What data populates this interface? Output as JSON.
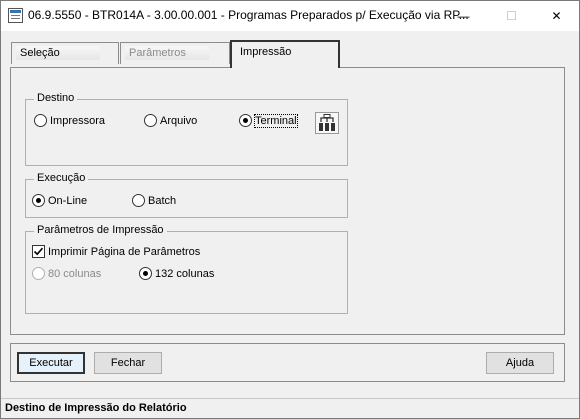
{
  "window": {
    "title": "06.9.5550 - BTR014A - 3.00.00.001 - Programas Preparados p/ Execução via RP...",
    "minimize_glyph": "—",
    "maximize_glyph": "☐",
    "close_glyph": "✕"
  },
  "tabs": [
    {
      "label": "Seleção",
      "state": "normal"
    },
    {
      "label": "Parâmetros",
      "state": "disabled"
    },
    {
      "label": "Impressão",
      "state": "active"
    }
  ],
  "destino": {
    "title": "Destino",
    "options": [
      {
        "label": "Impressora",
        "checked": false
      },
      {
        "label": "Arquivo",
        "checked": false
      },
      {
        "label": "Terminal",
        "checked": true
      }
    ],
    "terminal_icon": "terminal-config-icon"
  },
  "execucao": {
    "title": "Execução",
    "options": [
      {
        "label": "On-Line",
        "checked": true
      },
      {
        "label": "Batch",
        "checked": false
      }
    ]
  },
  "parametros_impressao": {
    "title": "Parâmetros de Impressão",
    "print_params_label": "Imprimir Página de Parâmetros",
    "print_params_checked": true,
    "options": [
      {
        "label": "80 colunas",
        "checked": false,
        "disabled": true
      },
      {
        "label": "132 colunas",
        "checked": true,
        "disabled": false
      }
    ]
  },
  "buttons": {
    "execute": "Executar",
    "close": "Fechar",
    "help": "Ajuda"
  },
  "status": "Destino de Impressão do Relatório"
}
